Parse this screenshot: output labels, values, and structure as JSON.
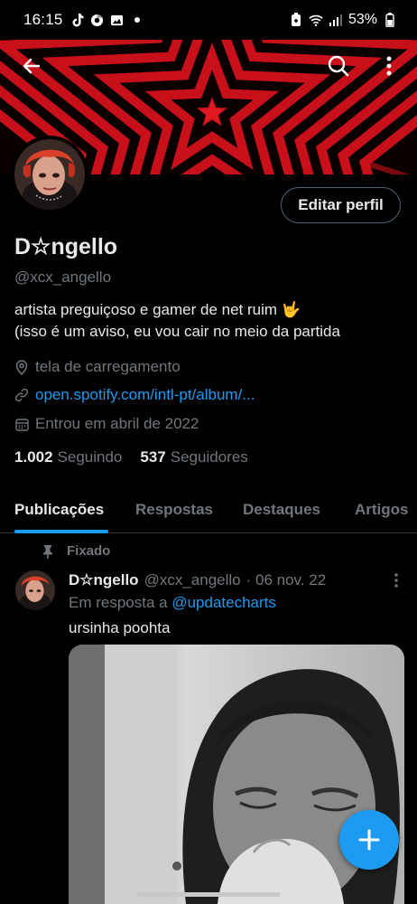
{
  "status_bar": {
    "time": "16:15",
    "battery": "53%",
    "left_icons": [
      "tiktok-icon",
      "chrome-icon",
      "gallery-icon",
      "dot-icon"
    ],
    "right_icons": [
      "lock-battery-icon",
      "wifi-icon",
      "signal-icon",
      "battery-icon"
    ]
  },
  "header": {
    "back_icon": "arrow-left-icon",
    "search_icon": "search-icon",
    "more_icon": "more-vertical-icon"
  },
  "profile": {
    "edit_button": "Editar perfil",
    "name": "D☆ngello",
    "handle": "@xcx_angello",
    "bio_line1": "artista preguiçoso e gamer de net ruim 🤟",
    "bio_line2": "(isso é um aviso, eu vou cair no meio da partida",
    "location": "tela de carregamento",
    "link": "open.spotify.com/intl-pt/album/...",
    "joined": "Entrou em abril de 2022",
    "following_count": "1.002",
    "following_label": "Seguindo",
    "followers_count": "537",
    "followers_label": "Seguidores"
  },
  "tabs": [
    {
      "label": "Publicações",
      "active": true
    },
    {
      "label": "Respostas",
      "active": false
    },
    {
      "label": "Destaques",
      "active": false
    },
    {
      "label": "Artigos",
      "active": false
    }
  ],
  "pinned_tweet": {
    "pinned_label": "Fixado",
    "name": "D☆ngello",
    "handle": "@xcx_angello",
    "date": "· 06 nov. 22",
    "reply_prefix": "Em resposta a",
    "reply_to": "@updatecharts",
    "text": "ursinha poohta"
  },
  "fab": {
    "icon": "plus-icon"
  },
  "colors": {
    "accent": "#1d9bf0",
    "banner_red": "#c8101a",
    "text_primary": "#e7e9ea",
    "text_secondary": "#71767b"
  }
}
